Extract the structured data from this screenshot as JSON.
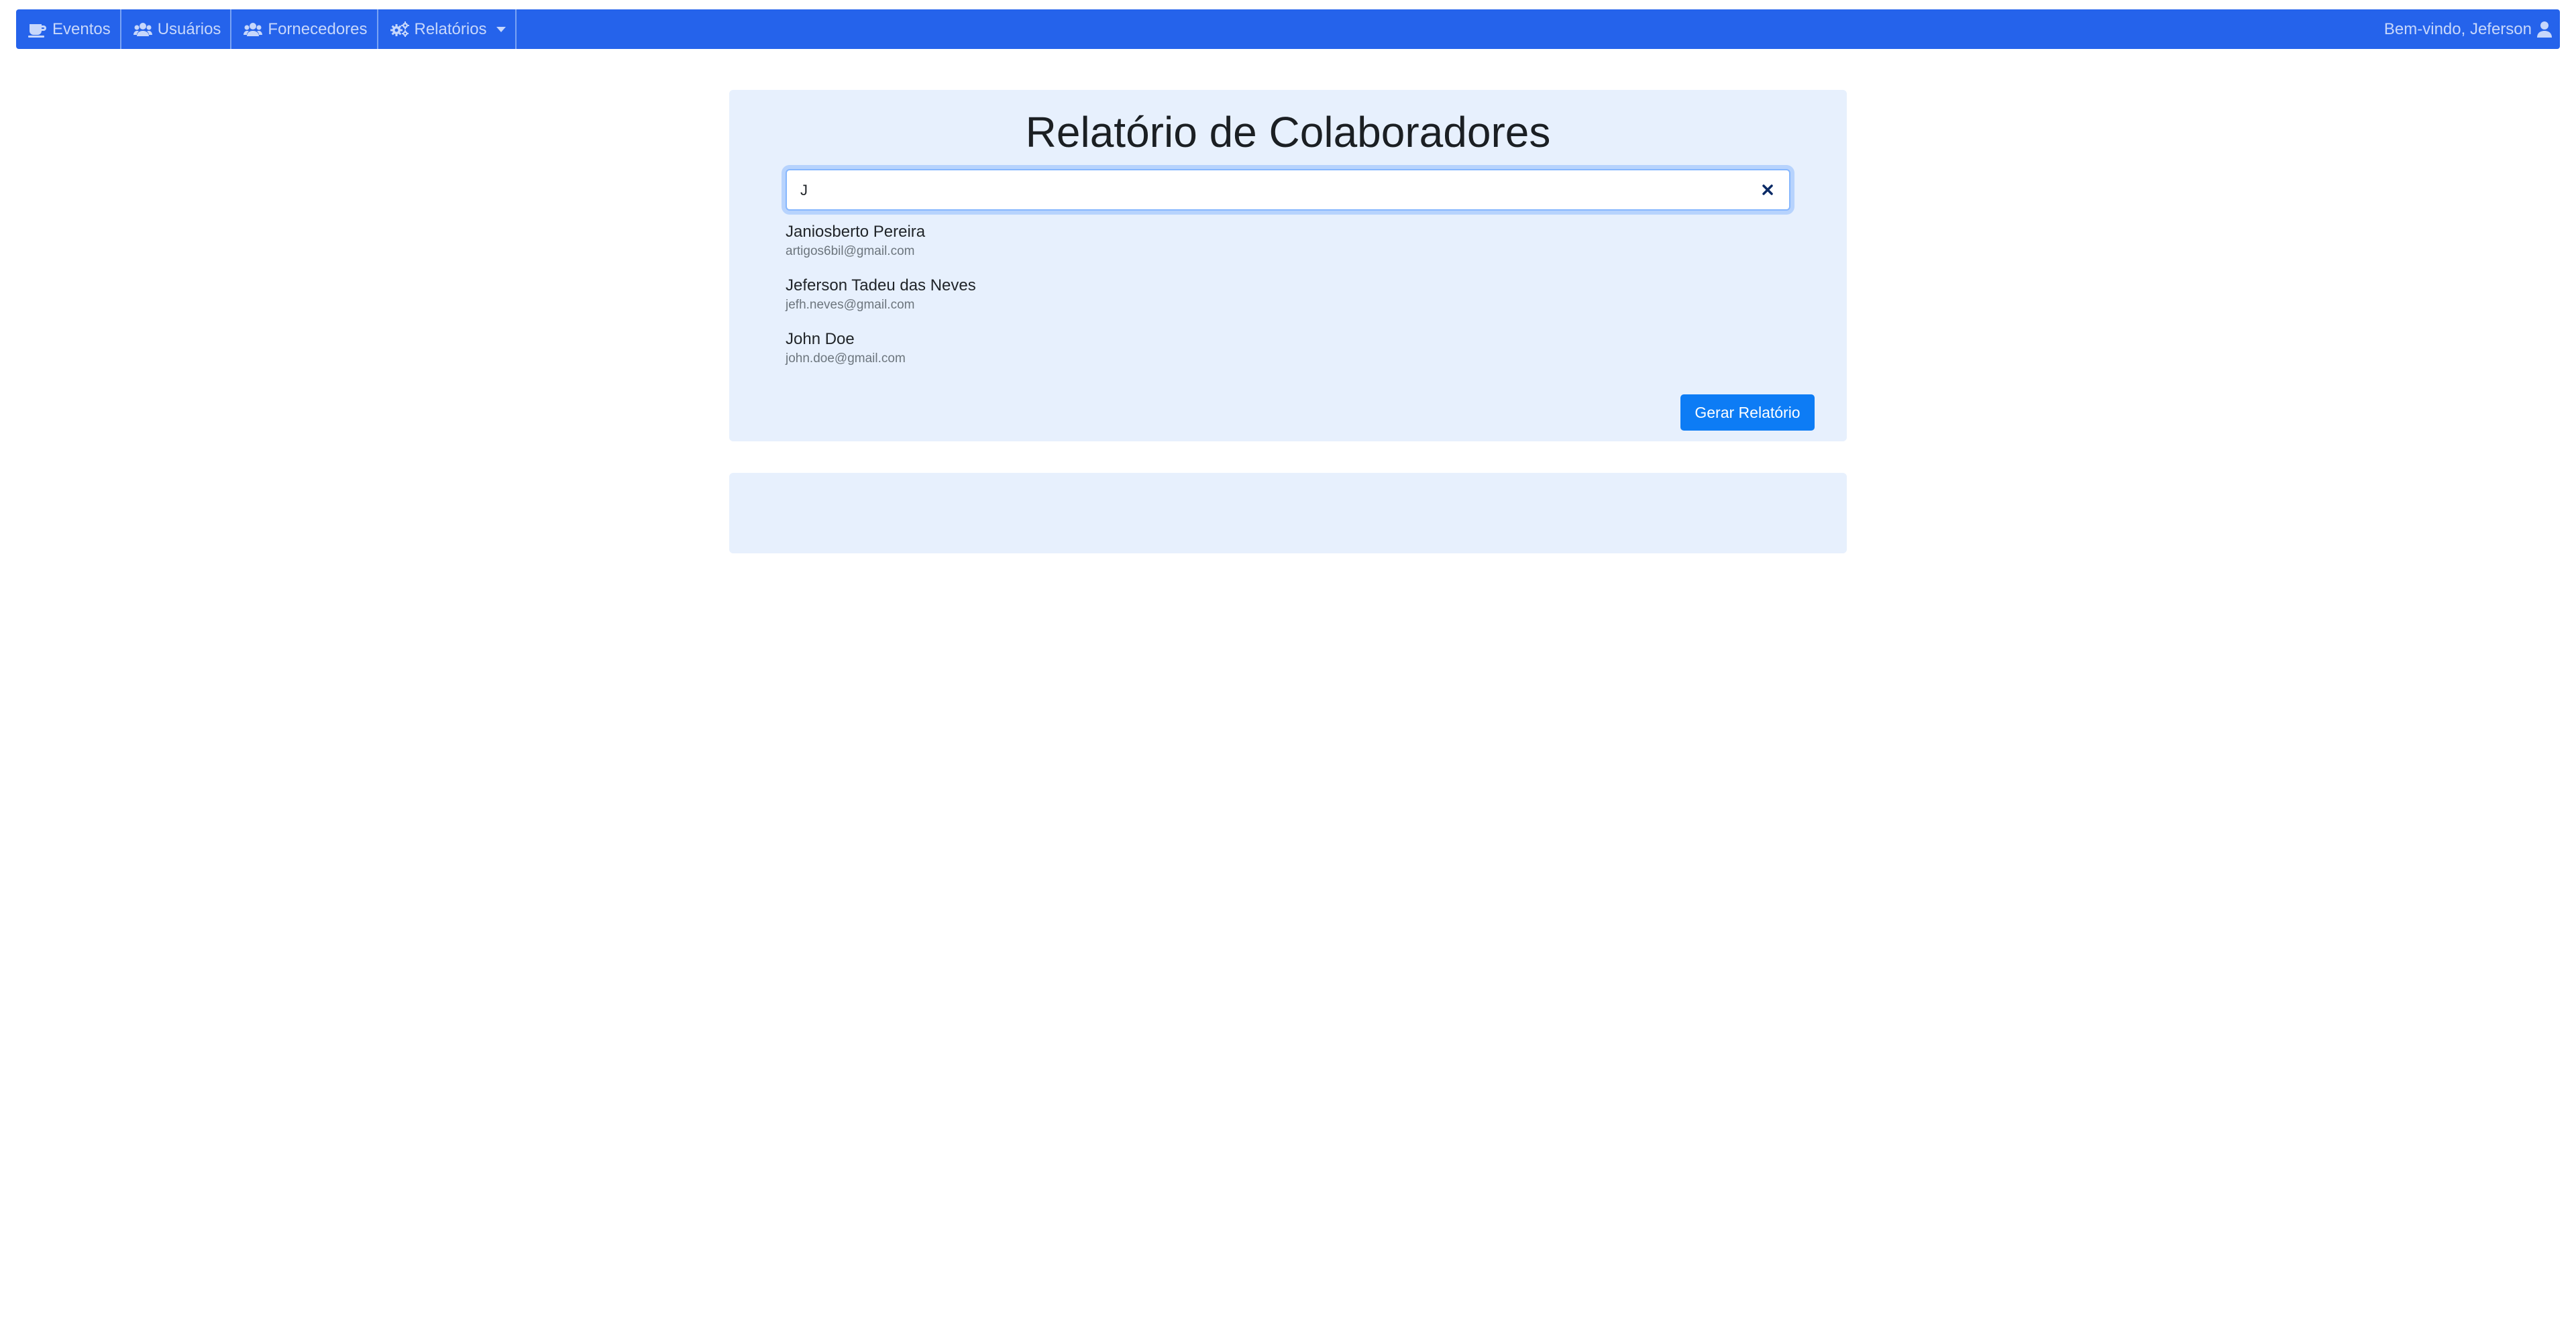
{
  "navbar": {
    "items": [
      {
        "label": "Eventos",
        "icon": "coffee-icon"
      },
      {
        "label": "Usuários",
        "icon": "users-icon"
      },
      {
        "label": "Fornecedores",
        "icon": "users-icon"
      },
      {
        "label": "Relatórios",
        "icon": "cogs-icon",
        "dropdown": true
      }
    ],
    "welcome": "Bem-vindo, Jeferson",
    "welcome_icon": "user-icon"
  },
  "report": {
    "title": "Relatório de Colaboradores",
    "search_value": "J",
    "clear_icon": "close-icon",
    "results": [
      {
        "name": "Janiosberto Pereira",
        "email": "artigos6bil@gmail.com"
      },
      {
        "name": "Jeferson Tadeu das Neves",
        "email": "jefh.neves@gmail.com"
      },
      {
        "name": "John Doe",
        "email": "john.doe@gmail.com"
      }
    ],
    "generate_label": "Gerar Relatório"
  },
  "colors": {
    "navbar_bg": "#2563eb",
    "panel_bg": "#e7f0fd",
    "button_bg": "#0d7cf5"
  }
}
